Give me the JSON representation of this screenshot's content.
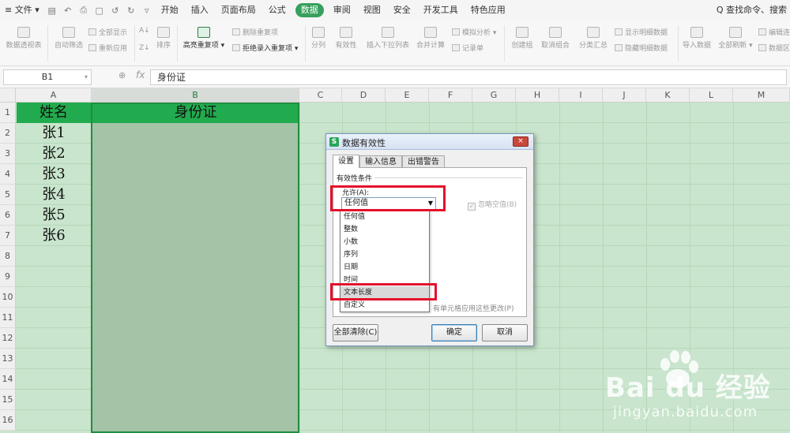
{
  "menubar": {
    "file_label": "≡ 文件 ▾",
    "quick_icons": [
      "save-icon",
      "undo-icon",
      "print-icon",
      "preview-icon",
      "redo-icon",
      "customize-icon"
    ],
    "tabs": [
      "开始",
      "插入",
      "页面布局",
      "公式",
      "数据",
      "审阅",
      "视图",
      "安全",
      "开发工具",
      "特色应用"
    ],
    "active_tab": "数据",
    "search_label": "Q 查找命令、搜索"
  },
  "ribbon": {
    "pivot": "数据透视表",
    "autofilter": "自动筛选",
    "show_all": "全部显示",
    "reapply": "重新应用",
    "sort": "排序",
    "highlight_dup": "高亮重复项",
    "delete_dup": "删除重复项",
    "reject_dup": "拒绝录入重复项",
    "split": "分列",
    "validity": "有效性",
    "dropdown": "插入下拉列表",
    "consolidate": "合并计算",
    "what_if": "模拟分析",
    "record": "记录单",
    "group": "创建组",
    "ungroup": "取消组合",
    "subtotal": "分类汇总",
    "show_detail": "显示明细数据",
    "hide_detail": "隐藏明细数据",
    "import": "导入数据",
    "refresh_all": "全部刷新",
    "edit_links": "编辑连",
    "data_tab": "数据区"
  },
  "formula_bar": {
    "name_box": "B1",
    "fx_label": "fx",
    "value": "身份证"
  },
  "grid": {
    "columns": [
      "A",
      "B",
      "C",
      "D",
      "E",
      "F",
      "G",
      "H",
      "I",
      "J",
      "K",
      "L",
      "M"
    ],
    "rows": [
      "1",
      "2",
      "3",
      "4",
      "5",
      "6",
      "7",
      "8",
      "9",
      "10",
      "11",
      "12",
      "13",
      "14",
      "15",
      "16"
    ],
    "headers": {
      "a1": "姓名",
      "b1": "身份证"
    },
    "names": [
      "张1",
      "张2",
      "张3",
      "张4",
      "张5",
      "张6"
    ]
  },
  "dialog": {
    "title": "数据有效性",
    "close_label": "×",
    "tabs": [
      "设置",
      "输入信息",
      "出错警告"
    ],
    "section_title": "有效性条件",
    "allow_label": "允许(A):",
    "allow_value": "任何值",
    "ignore_blank": "忽略空值(B)",
    "apply_all": "有单元格应用这些更改(P)",
    "options": [
      "任何值",
      "整数",
      "小数",
      "序列",
      "日期",
      "时间",
      "文本长度",
      "自定义"
    ],
    "highlighted_option": "文本长度",
    "clear_all": "全部清除(C)",
    "ok": "确定",
    "cancel": "取消"
  },
  "watermark": {
    "main": "Bai du 经验",
    "sub": "jingyan.baidu.com"
  },
  "colors": {
    "accent": "#36a05c",
    "header_fill": "#22ab4e",
    "sheet_bg": "#c9e5cd",
    "highlight_red": "#e3112b"
  }
}
